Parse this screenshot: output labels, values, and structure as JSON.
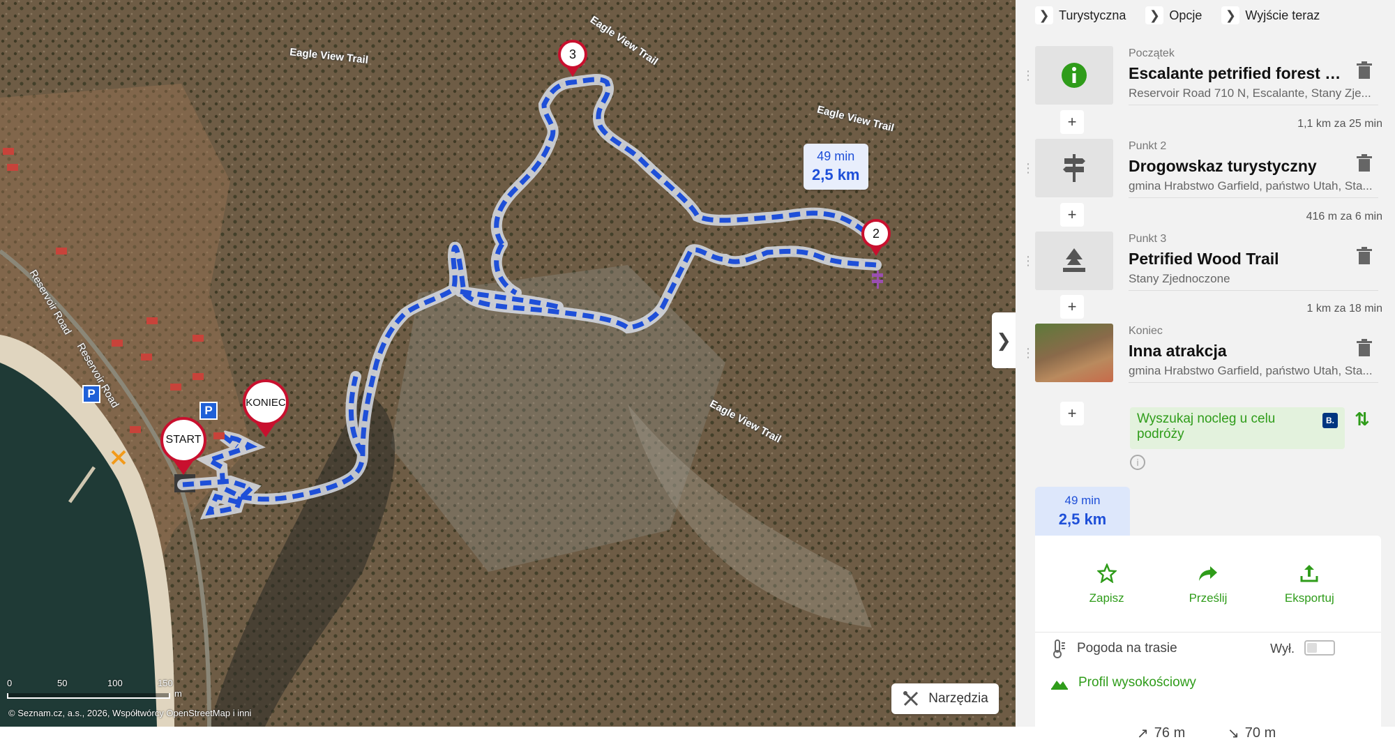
{
  "map": {
    "trail_labels": [
      "Eagle View Trail",
      "Eagle View Trail",
      "Eagle View Trail",
      "Eagle View Trail"
    ],
    "road_labels": [
      "Reservoir Road",
      "Reservoir Road"
    ],
    "pins": {
      "start": "START",
      "end": "KONIEC",
      "p2": "2",
      "p3": "3"
    },
    "parking_symbol": "P",
    "route_bubble": {
      "time": "49 min",
      "distance": "2,5 km"
    },
    "scale": {
      "ticks": [
        "0",
        "50",
        "100",
        "150"
      ],
      "unit": "m"
    },
    "attribution": "© Seznam.cz, a.s., 2026, Współtwórcy OpenStreetMap i inni",
    "tools_label": "Narzędzia",
    "collapse_icon": "chevron-right-icon",
    "colors": {
      "route": "#1e4fd8",
      "pin": "#c8102e"
    }
  },
  "panel": {
    "topbar": [
      {
        "label": "Turystyczna"
      },
      {
        "label": "Opcje"
      },
      {
        "label": "Wyjście teraz"
      }
    ],
    "waypoints": [
      {
        "role": "Początek",
        "name": "Escalante petrified forest S...",
        "address": "Reservoir Road 710 N, Escalante, Stany Zje...",
        "icon": "info-icon"
      },
      {
        "role": "Punkt 2",
        "name": "Drogowskaz turystyczny",
        "address": "gmina Hrabstwo Garfield, państwo Utah, Sta...",
        "icon": "signpost-icon"
      },
      {
        "role": "Punkt 3",
        "name": "Petrified Wood Trail",
        "address": "Stany Zjednoczone",
        "icon": "trail-icon"
      },
      {
        "role": "Koniec",
        "name": "Inna atrakcja",
        "address": "gmina Hrabstwo Garfield, państwo Utah, Sta...",
        "icon": "photo-thumbnail"
      }
    ],
    "segments": [
      "1,1 km za 25 min",
      "416 m za 6 min",
      "1 km za 18 min"
    ],
    "plus_symbol": "+",
    "booking": {
      "text": "Wyszukaj nocleg u celu podróży",
      "badge": "B."
    },
    "summary": {
      "time": "49 min",
      "distance": "2,5 km"
    },
    "actions": [
      {
        "label": "Zapisz",
        "icon": "star-icon"
      },
      {
        "label": "Prześlij",
        "icon": "share-arrow-icon"
      },
      {
        "label": "Eksportuj",
        "icon": "export-icon"
      }
    ],
    "weather": {
      "label": "Pogoda na trasie",
      "state": "Wył."
    },
    "elevation": {
      "label": "Profil wysokościowy",
      "up": "76 m",
      "down": "70 m"
    },
    "accent": "#2f9c1a"
  }
}
